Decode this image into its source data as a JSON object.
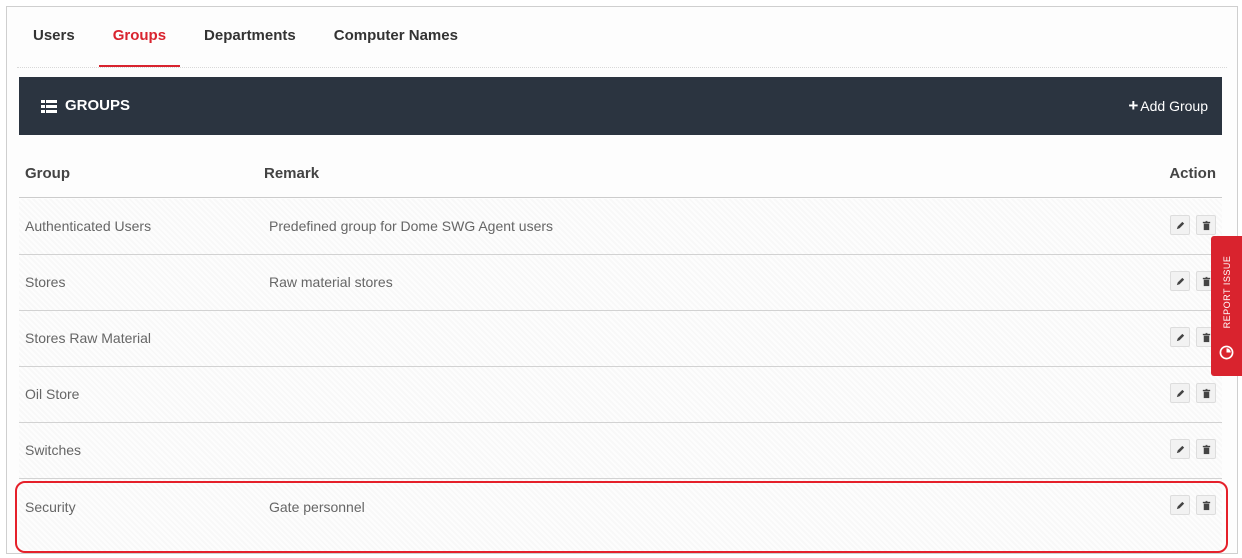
{
  "tabs": [
    {
      "label": "Users",
      "active": false
    },
    {
      "label": "Groups",
      "active": true
    },
    {
      "label": "Departments",
      "active": false
    },
    {
      "label": "Computer Names",
      "active": false
    }
  ],
  "panel": {
    "title": "GROUPS",
    "title_icon": "list-icon",
    "add_label": "Add Group",
    "add_icon": "plus-icon"
  },
  "table": {
    "columns": {
      "group": "Group",
      "remark": "Remark",
      "action": "Action"
    },
    "rows": [
      {
        "group": "Authenticated Users",
        "remark": "Predefined group for Dome SWG Agent users"
      },
      {
        "group": "Stores",
        "remark": "Raw material stores"
      },
      {
        "group": "Stores Raw Material",
        "remark": ""
      },
      {
        "group": "Oil Store",
        "remark": ""
      },
      {
        "group": "Switches",
        "remark": ""
      },
      {
        "group": "Security",
        "remark": "Gate personnel",
        "highlighted": true
      }
    ],
    "row_actions": [
      "edit-icon",
      "delete-icon"
    ]
  },
  "report_issue": {
    "label": "REPORT ISSUE",
    "icon": "report-icon"
  },
  "colors": {
    "accent": "#d9232e",
    "header_bg": "#2b3440",
    "highlight_border": "#e5202a"
  }
}
